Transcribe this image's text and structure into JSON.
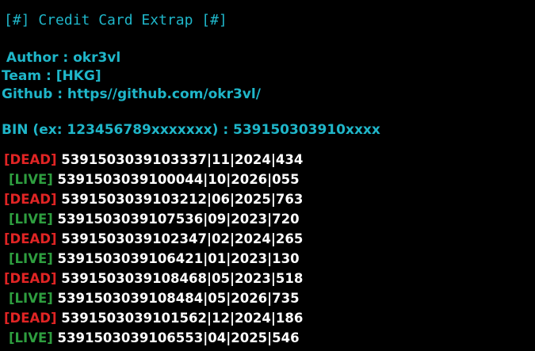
{
  "banner": "[#] Credit Card Extrap [#]",
  "info": {
    "author": " Author : okr3vl",
    "team": "Team : [HKG]",
    "github": "Github : https//github.com/okr3vl/",
    "bin_prompt": "BIN (ex: 123456789xxxxxxx) : 539150303910xxxx"
  },
  "results": [
    {
      "status": "[DEAD]",
      "card": "5391503039103337|11|2024|434"
    },
    {
      "status": "[LIVE]",
      "card": "5391503039100044|10|2026|055"
    },
    {
      "status": "[DEAD]",
      "card": "5391503039103212|06|2025|763"
    },
    {
      "status": "[LIVE]",
      "card": "5391503039107536|09|2023|720"
    },
    {
      "status": "[DEAD]",
      "card": "5391503039102347|02|2024|265"
    },
    {
      "status": "[LIVE]",
      "card": "5391503039106421|01|2023|130"
    },
    {
      "status": "[DEAD]",
      "card": "5391503039108468|05|2023|518"
    },
    {
      "status": "[LIVE]",
      "card": "5391503039108484|05|2026|735"
    },
    {
      "status": "[DEAD]",
      "card": "5391503039101562|12|2024|186"
    },
    {
      "status": "[LIVE]",
      "card": "5391503039106553|04|2025|546"
    }
  ],
  "colors": {
    "background": "#000000",
    "cyan": "#1fb6c9",
    "dead": "#e02424",
    "live": "#2e9e3f",
    "text": "#ffffff"
  }
}
